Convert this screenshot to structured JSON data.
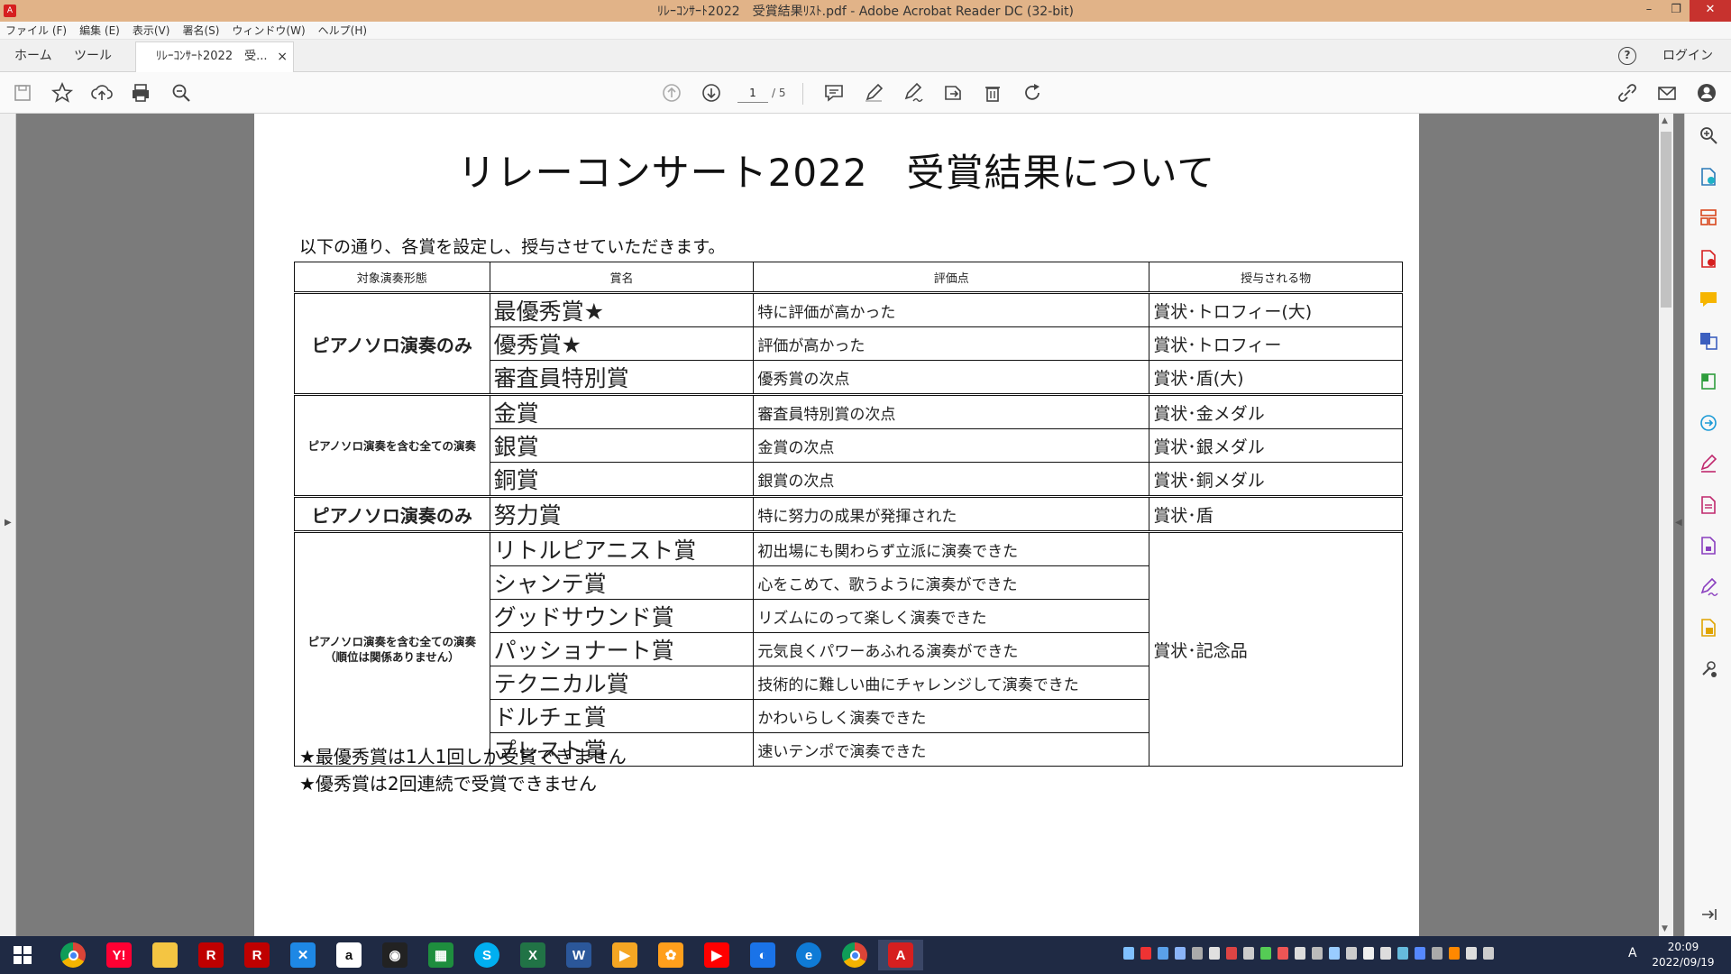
{
  "window": {
    "title": "ﾘﾚｰｺﾝｻｰﾄ2022　受賞結果ﾘｽﾄ.pdf - Adobe Acrobat Reader DC (32-bit)",
    "controls": [
      "–",
      "❐",
      "✕"
    ]
  },
  "menu": [
    "ファイル (F)",
    "編集 (E)",
    "表示(V)",
    "署名(S)",
    "ウィンドウ(W)",
    "ヘルプ(H)"
  ],
  "tabs": {
    "home": "ホーム",
    "tools": "ツール",
    "document": "ﾘﾚｰｺﾝｻｰﾄ2022　受...",
    "close": "×",
    "login": "ログイン",
    "help": "?"
  },
  "toolbar": {
    "page_current": "1",
    "page_total": "/ 5"
  },
  "document": {
    "title": "リレーコンサート2022　受賞結果について",
    "intro": "以下の通り、各賞を設定し、授与させていただきます。",
    "headers": [
      "対象演奏形態",
      "賞名",
      "評価点",
      "授与される物"
    ],
    "forms": {
      "piano_only": "ピアノソロ演奏のみ",
      "all": "ピアノソロ演奏を含む全ての演奏",
      "all_note": "（順位は関係ありません）"
    },
    "rows": [
      {
        "award": "最優秀賞★",
        "criteria": "特に評価が高かった",
        "prize": "賞状･トロフィー(大)"
      },
      {
        "award": "優秀賞★",
        "criteria": "評価が高かった",
        "prize": "賞状･トロフィー"
      },
      {
        "award": "審査員特別賞",
        "criteria": "優秀賞の次点",
        "prize": "賞状･盾(大)"
      },
      {
        "award": "金賞",
        "criteria": "審査員特別賞の次点",
        "prize": "賞状･金メダル"
      },
      {
        "award": "銀賞",
        "criteria": "金賞の次点",
        "prize": "賞状･銀メダル"
      },
      {
        "award": "銅賞",
        "criteria": "銀賞の次点",
        "prize": "賞状･銅メダル"
      },
      {
        "award": "努力賞",
        "criteria": "特に努力の成果が発揮された",
        "prize": "賞状･盾"
      },
      {
        "award": "リトルピアニスト賞",
        "criteria": "初出場にも関わらず立派に演奏できた",
        "prize": "賞状･記念品"
      },
      {
        "award": "シャンテ賞",
        "criteria": "心をこめて、歌うように演奏ができた"
      },
      {
        "award": "グッドサウンド賞",
        "criteria": "リズムにのって楽しく演奏できた"
      },
      {
        "award": "パッショナート賞",
        "criteria": "元気良くパワーあふれる演奏ができた"
      },
      {
        "award": "テクニカル賞",
        "criteria": "技術的に難しい曲にチャレンジして演奏できた"
      },
      {
        "award": "ドルチェ賞",
        "criteria": "かわいらしく演奏できた"
      },
      {
        "award": "プレスト賞",
        "criteria": "速いテンポで演奏できた"
      }
    ],
    "notes": [
      "★最優秀賞は1人1回しか受賞できません",
      "★優秀賞は2回連続で受賞できません"
    ]
  },
  "taskbar": {
    "time": "20:09",
    "date": "2022/09/19",
    "ime": "A",
    "apps": [
      {
        "name": "chrome",
        "color": "#db4437",
        "label": ""
      },
      {
        "name": "yahoo",
        "color": "#ff0033",
        "label": "Y!"
      },
      {
        "name": "explorer",
        "color": "#f4c542",
        "label": ""
      },
      {
        "name": "rakuten",
        "color": "#bf0000",
        "label": "R"
      },
      {
        "name": "rakuten-r",
        "color": "#bf0000",
        "label": "R"
      },
      {
        "name": "app-x",
        "color": "#1e88e5",
        "label": "✕"
      },
      {
        "name": "amazon",
        "color": "#ffffff",
        "label": "a"
      },
      {
        "name": "eye-app",
        "color": "#222222",
        "label": "◉"
      },
      {
        "name": "calc-green",
        "color": "#1e8e3e",
        "label": "▦"
      },
      {
        "name": "skype",
        "color": "#00aff0",
        "label": "S"
      },
      {
        "name": "excel",
        "color": "#217346",
        "label": "X"
      },
      {
        "name": "word",
        "color": "#2b579a",
        "label": "W"
      },
      {
        "name": "media-player",
        "color": "#f5a623",
        "label": "▶"
      },
      {
        "name": "photo-app",
        "color": "#ff9f1c",
        "label": "✿"
      },
      {
        "name": "youtube",
        "color": "#ff0000",
        "label": "▶"
      },
      {
        "name": "globe-app",
        "color": "#1a73e8",
        "label": "◐"
      },
      {
        "name": "edge",
        "color": "#0f7bd6",
        "label": "e"
      },
      {
        "name": "chrome-2",
        "color": "#db4437",
        "label": ""
      },
      {
        "name": "acrobat",
        "color": "#d61f1f",
        "label": "A"
      }
    ]
  }
}
